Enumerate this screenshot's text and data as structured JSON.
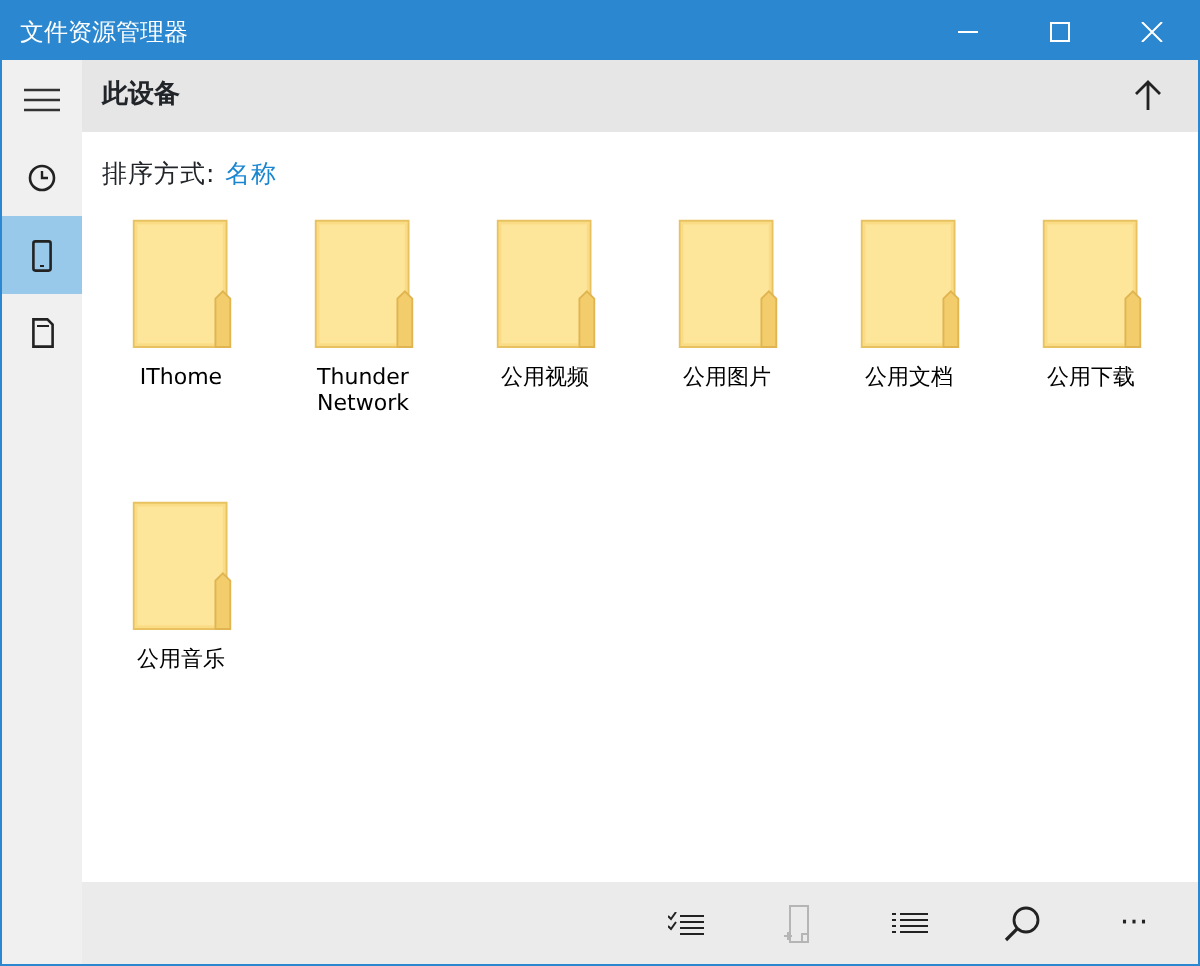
{
  "window": {
    "title": "文件资源管理器"
  },
  "title_buttons": [
    {
      "kind": "minimize"
    },
    {
      "kind": "maximize"
    },
    {
      "kind": "close"
    }
  ],
  "rail": [
    {
      "kind": "menu",
      "selected": false
    },
    {
      "kind": "recent",
      "selected": false
    },
    {
      "kind": "device",
      "selected": true
    },
    {
      "kind": "sdcard",
      "selected": false
    }
  ],
  "header": {
    "title": "此设备"
  },
  "sort": {
    "label": "排序方式:",
    "value": "名称"
  },
  "folders": [
    {
      "name": "IThome"
    },
    {
      "name": "Thunder Network"
    },
    {
      "name": "公用视频"
    },
    {
      "name": "公用图片"
    },
    {
      "name": "公用文档"
    },
    {
      "name": "公用下载"
    },
    {
      "name": "公用音乐"
    }
  ],
  "toolbar": [
    {
      "kind": "select",
      "disabled": false
    },
    {
      "kind": "newfolder",
      "disabled": true
    },
    {
      "kind": "list",
      "disabled": false
    },
    {
      "kind": "search",
      "disabled": false
    },
    {
      "kind": "more",
      "label": "···",
      "disabled": false
    }
  ]
}
